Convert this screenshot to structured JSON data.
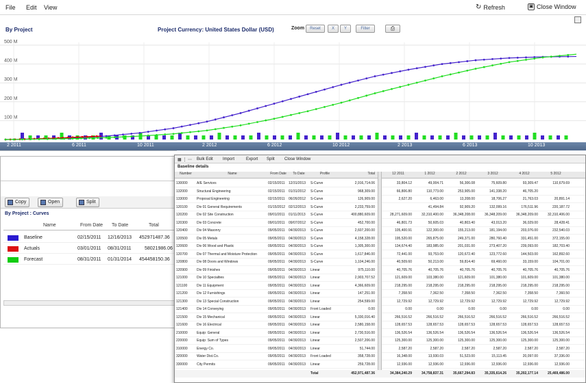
{
  "menubar": {
    "items": [
      "File",
      "Edit",
      "View"
    ],
    "refresh_label": "Refresh",
    "close_label": "Close Window"
  },
  "chart_header": {
    "title": "By Project",
    "currency": "Project Currency: United States Dollar (USD)",
    "zoom_label": "Zoom",
    "reset_label": "Reset",
    "btn_x": "X",
    "btn_y": "Y",
    "filter_label": "Filter"
  },
  "chart_data": {
    "type": "line",
    "y_ticks": [
      "500 M",
      "400 M",
      "300 M",
      "200 M",
      "100 M"
    ],
    "x_ticks": [
      "2 2011",
      "6 2011",
      "10 2011",
      "2 2012",
      "6 2012",
      "10 2012",
      "2 2013",
      "6 2013",
      "10 2013"
    ],
    "ylim": [
      0,
      500
    ],
    "series": [
      {
        "name": "Baseline",
        "color": "#4422cc",
        "values": [
          0,
          3,
          8,
          18,
          35,
          60,
          95,
          140,
          190,
          240,
          290,
          335,
          370,
          400,
          420,
          432,
          438,
          440
        ]
      },
      {
        "name": "Actuals",
        "color": "#dd0000",
        "values": [
          0,
          2,
          5,
          9,
          14,
          18
        ]
      },
      {
        "name": "Forecast",
        "color": "#22dd22",
        "values": [
          0,
          2,
          5,
          10,
          18,
          30,
          48,
          75,
          110,
          150,
          195,
          245,
          290,
          335,
          375,
          410,
          435,
          452
        ]
      }
    ]
  },
  "left_panel": {
    "copy_label": "Copy",
    "open_label": "Open",
    "split_label": "Split",
    "section_title": "By Project : Curves",
    "columns": [
      "Name",
      "From Date",
      "To Date",
      "Total"
    ],
    "rows": [
      {
        "name": "Baseline",
        "from": "02/15/2011",
        "to": "12/16/2013",
        "total": "452971487.36",
        "color": "#2a1ad0"
      },
      {
        "name": "Actuals",
        "from": "03/01/2011",
        "to": "08/31/2011",
        "total": "58021986.06",
        "color": "#dd1111"
      },
      {
        "name": "Forecast",
        "from": "08/31/2011",
        "to": "01/31/2014",
        "total": "454458150.36",
        "color": "#11cc11"
      }
    ]
  },
  "table_window": {
    "toolbar": [
      "Bulk Edit",
      "Import",
      "Export",
      "Split",
      "Close Window"
    ],
    "section": "Baseline details",
    "left_columns": [
      "Number",
      "Name",
      "From Date",
      "To Date",
      "Profile",
      "Total"
    ],
    "right_columns": [
      "12 2011",
      "1 2012",
      "2 2012",
      "3 2012",
      "4 2012",
      "5 2012"
    ],
    "rows": [
      [
        "130000",
        "A/E Services",
        "02/15/2011",
        "12/31/2013",
        "S-Curve",
        "2,916,714.06",
        "33,804.12",
        "49,004.71",
        "56,306.08",
        "75,609.80",
        "93,309.47",
        "110,679.69"
      ],
      [
        "132000",
        "Structural Engineering",
        "02/15/2011",
        "01/31/2012",
        "S-Curve",
        "968,309.00",
        "66,806.80",
        "110,773.00",
        "253,905.00",
        "141,338.20",
        "46,705.20",
        ""
      ],
      [
        "133000",
        "Proposal Engineering",
        "02/15/2011",
        "06/26/2012",
        "S-Curve",
        "126,909.00",
        "2,627.20",
        "6,463.00",
        "13,208.00",
        "18,706.27",
        "21,763.03",
        "20,891.14"
      ],
      [
        "120100",
        "Div 01 General Requirements",
        "01/15/2012",
        "02/12/2013",
        "S-Curve",
        "2,233,759.00",
        "",
        "41,494.84",
        "92,909.20",
        "132,099.16",
        "176,511.96",
        "220,187.72"
      ],
      [
        "120200",
        "Div 02 Site Construction",
        "09/01/2011",
        "01/11/2013",
        "S-Curve",
        "400,880,609.00",
        "28,271,609.00",
        "32,310,400.00",
        "36,348,208.00",
        "36,348,209.00",
        "36,348,209.00",
        "32,310,406.00"
      ],
      [
        "120300",
        "Div 03 Concrete",
        "09/01/2011",
        "09/07/2012",
        "S-Curve",
        "452,700.00",
        "46,801.73",
        "50,605.03",
        "40,803.40",
        "43,013.20",
        "36,029.00",
        "28,428.41"
      ],
      [
        "120400",
        "Div 04 Masonry",
        "09/05/2011",
        "04/30/2013",
        "S-Curve",
        "2,607,200.00",
        "105,400.91",
        "122,300.00",
        "155,213.00",
        "181,194.00",
        "203,076.00",
        "232,540.03"
      ],
      [
        "120500",
        "Div 05 Metals",
        "09/05/2011",
        "04/30/2013",
        "S-Curve",
        "4,158,328.00",
        "195,520.00",
        "265,875.00",
        "249,371.00",
        "280,760.40",
        "331,451.00",
        "372,155.00"
      ],
      [
        "120600",
        "Div 06 Wood and Plastic",
        "09/05/2011",
        "04/30/2013",
        "S-Curve",
        "1,305,300.00",
        "134,674.40",
        "183,985.00",
        "201,031.00",
        "273,407.20",
        "239,093.00",
        "182,703.40"
      ],
      [
        "120700",
        "Div 07 Thermal and Moisture Protection",
        "09/05/2011",
        "04/30/2013",
        "S-Curve",
        "1,617,846.00",
        "72,441.00",
        "93,753.00",
        "120,672.40",
        "123,772.60",
        "144,503.00",
        "162,892.60"
      ],
      [
        "120800",
        "Div 08 Doors and Windows",
        "09/05/2011",
        "04/30/2013",
        "S-Curve",
        "1,104,246.00",
        "40,509.60",
        "50,213.00",
        "59,814.40",
        "69,460.00",
        "33,159.00",
        "104,701.00"
      ],
      [
        "120900",
        "Div 09 Finishes",
        "09/05/2011",
        "04/30/2013",
        "Linear",
        "975,110.00",
        "40,705.76",
        "40,705.76",
        "40,705.76",
        "40,705.76",
        "40,705.76",
        "40,705.76"
      ],
      [
        "121000",
        "Div 10 Specialties",
        "09/05/2011",
        "04/30/2013",
        "Linear",
        "2,903,707.52",
        "121,609.00",
        "103,380.00",
        "121,609.00",
        "101,380.00",
        "101,609.00",
        "101,380.00"
      ],
      [
        "121100",
        "Div 11 Equipment",
        "09/05/2011",
        "04/30/2013",
        "Linear",
        "4,366,609.00",
        "218,295.00",
        "218,295.00",
        "218,295.00",
        "218,295.00",
        "218,295.00",
        "218,295.00"
      ],
      [
        "121200",
        "Div 12 Furnishings",
        "09/05/2011",
        "04/30/2013",
        "Linear",
        "147,251.00",
        "7,358.50",
        "7,362.50",
        "7,358.50",
        "7,362.50",
        "7,358.50",
        "7,360.50"
      ],
      [
        "121300",
        "Div 13 Special Construction",
        "09/05/2011",
        "04/30/2013",
        "Linear",
        "254,599.00",
        "12,729.92",
        "12,729.92",
        "12,729.92",
        "12,729.92",
        "12,729.92",
        "12,729.92"
      ],
      [
        "121400",
        "Div 14 Conveying",
        "09/05/2011",
        "04/30/2013",
        "Front Loaded",
        "0.00",
        "0.00",
        "0.00",
        "0.00",
        "0.00",
        "0.00",
        "0.00"
      ],
      [
        "121500",
        "Div 15 Mechanical",
        "09/05/2011",
        "04/30/2013",
        "Linear",
        "5,330,016.40",
        "266,516.52",
        "266,516.52",
        "266,516.52",
        "266,516.52",
        "266,516.52",
        "266,516.52"
      ],
      [
        "121600",
        "Div 16 Electrical",
        "09/05/2011",
        "04/30/2013",
        "Linear",
        "2,580,158.00",
        "128,657.53",
        "128,657.53",
        "128,657.53",
        "128,657.53",
        "128,657.53",
        "128,657.53"
      ],
      [
        "210000",
        "Equip: General",
        "09/05/2011",
        "04/30/2013",
        "Linear",
        "2,730,516.00",
        "136,526.54",
        "136,526.54",
        "136,526.54",
        "136,526.54",
        "136,526.54",
        "136,526.54"
      ],
      [
        "220000",
        "Equip: Sum of Types",
        "09/05/2011",
        "04/30/2013",
        "Linear",
        "2,507,206.00",
        "125,300.00",
        "125,300.00",
        "125,300.00",
        "125,300.00",
        "125,300.00",
        "125,300.00"
      ],
      [
        "310000",
        "Energy Co.",
        "09/05/2011",
        "04/30/2013",
        "Linear",
        "51,744.00",
        "2,587.20",
        "2,587.20",
        "2,587.20",
        "2,587.20",
        "2,587.20",
        "2,587.20"
      ],
      [
        "320000",
        "Water Dist.Co.",
        "09/05/2011",
        "04/30/2013",
        "Front Loaded",
        "358,728.00",
        "16,348.00",
        "13,930.03",
        "51,523.00",
        "15,113.45",
        "20,097.00",
        "37,336.00"
      ],
      [
        "330000",
        "City Permits",
        "09/05/2011",
        "04/30/2013",
        "Linear",
        "259,728.00",
        "12,936.00",
        "12,936.00",
        "12,936.00",
        "12,936.00",
        "12,936.00",
        "12,936.00"
      ]
    ],
    "total_label": "Total",
    "totals": [
      "452,971,487.36",
      "34,384,240.29",
      "34,758,837.31",
      "35,667,294.83",
      "35,335,614.26",
      "35,202,177.14",
      "25,469,486.00"
    ]
  },
  "colors": {
    "axis_bar": "#5a7496",
    "header_blue": "#1a2a6a"
  }
}
